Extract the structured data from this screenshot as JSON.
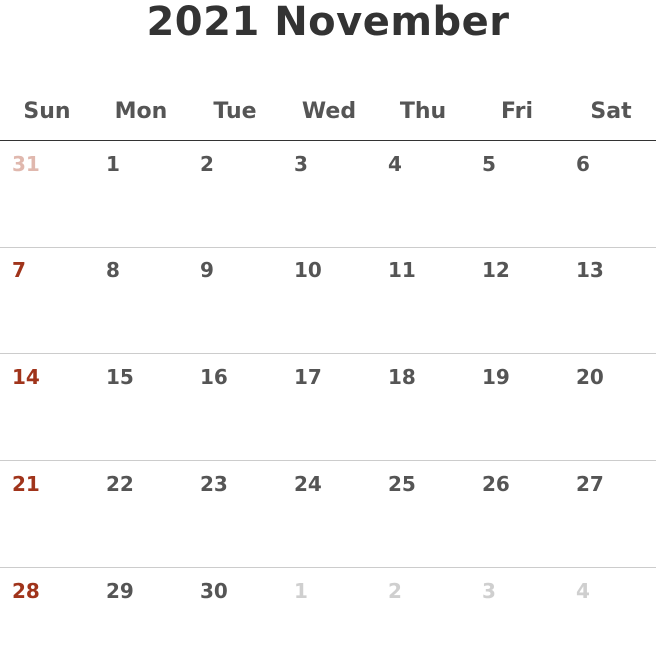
{
  "calendar": {
    "title": "2021 November",
    "weekdays": [
      "Sun",
      "Mon",
      "Tue",
      "Wed",
      "Thu",
      "Fri",
      "Sat"
    ],
    "weeks": [
      [
        {
          "day": "31",
          "current": false
        },
        {
          "day": "1",
          "current": true
        },
        {
          "day": "2",
          "current": true
        },
        {
          "day": "3",
          "current": true
        },
        {
          "day": "4",
          "current": true
        },
        {
          "day": "5",
          "current": true
        },
        {
          "day": "6",
          "current": true
        }
      ],
      [
        {
          "day": "7",
          "current": true
        },
        {
          "day": "8",
          "current": true
        },
        {
          "day": "9",
          "current": true
        },
        {
          "day": "10",
          "current": true
        },
        {
          "day": "11",
          "current": true
        },
        {
          "day": "12",
          "current": true
        },
        {
          "day": "13",
          "current": true
        }
      ],
      [
        {
          "day": "14",
          "current": true
        },
        {
          "day": "15",
          "current": true
        },
        {
          "day": "16",
          "current": true
        },
        {
          "day": "17",
          "current": true
        },
        {
          "day": "18",
          "current": true
        },
        {
          "day": "19",
          "current": true
        },
        {
          "day": "20",
          "current": true
        }
      ],
      [
        {
          "day": "21",
          "current": true
        },
        {
          "day": "22",
          "current": true
        },
        {
          "day": "23",
          "current": true
        },
        {
          "day": "24",
          "current": true
        },
        {
          "day": "25",
          "current": true
        },
        {
          "day": "26",
          "current": true
        },
        {
          "day": "27",
          "current": true
        }
      ],
      [
        {
          "day": "28",
          "current": true
        },
        {
          "day": "29",
          "current": true
        },
        {
          "day": "30",
          "current": true
        },
        {
          "day": "1",
          "current": false
        },
        {
          "day": "2",
          "current": false
        },
        {
          "day": "3",
          "current": false
        },
        {
          "day": "4",
          "current": false
        }
      ]
    ]
  },
  "colors": {
    "title": "#333333",
    "text": "#555555",
    "sunday": "#a0341b",
    "outside_month": "#cfcfcf",
    "outside_month_sunday": "#e0b8ae",
    "header_rule": "#333333",
    "week_rule": "#cccccc"
  }
}
